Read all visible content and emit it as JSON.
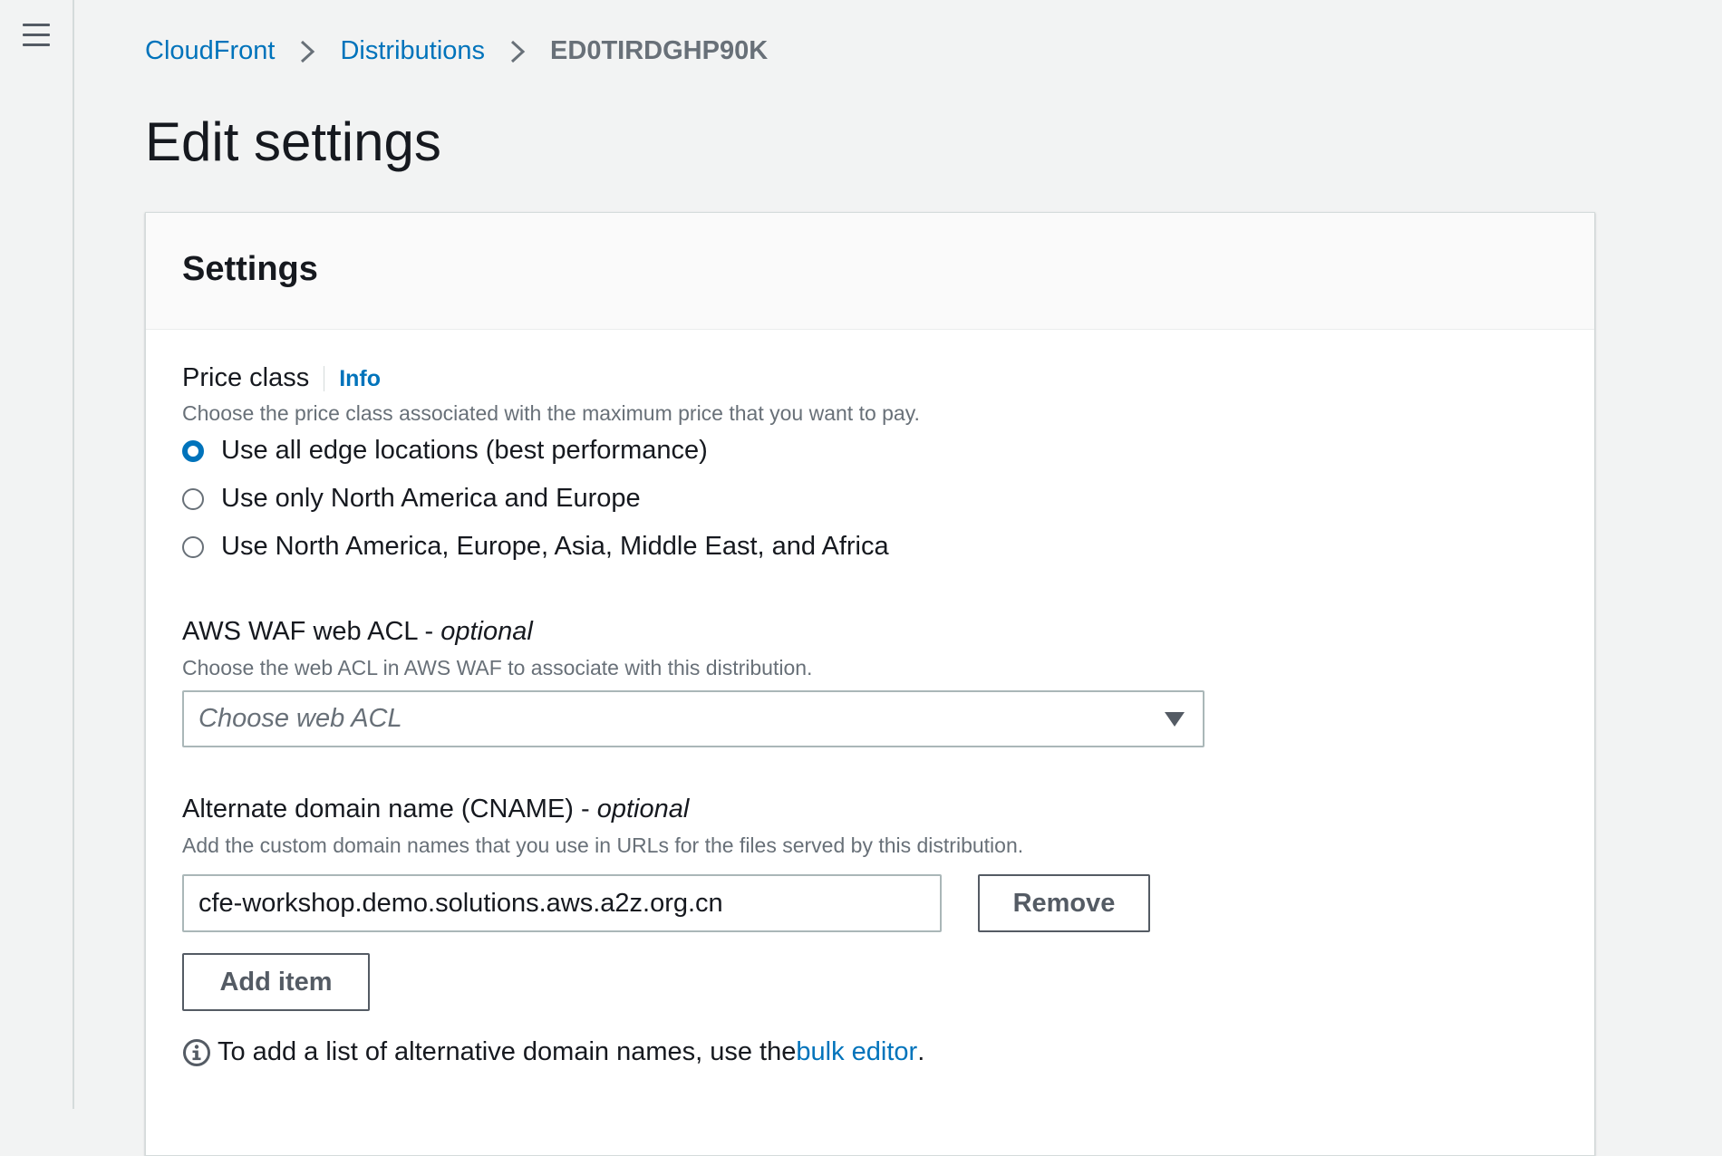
{
  "sidebar": {
    "menu_icon": "hamburger-menu-icon"
  },
  "breadcrumb": {
    "items": [
      {
        "label": "CloudFront"
      },
      {
        "label": "Distributions"
      }
    ],
    "current": "ED0TIRDGHP90K",
    "separator_icon": "chevron-right-icon"
  },
  "page": {
    "title": "Edit settings"
  },
  "settings": {
    "title": "Settings",
    "price_class": {
      "label": "Price class",
      "info_link": "Info",
      "description": "Choose the price class associated with the maximum price that you want to pay.",
      "options": [
        {
          "label": "Use all edge locations (best performance)",
          "selected": true
        },
        {
          "label": "Use only North America and Europe",
          "selected": false
        },
        {
          "label": "Use North America, Europe, Asia, Middle East, and Africa",
          "selected": false
        }
      ]
    },
    "waf": {
      "label": "AWS WAF web ACL - ",
      "optional": "optional",
      "description": "Choose the web ACL in AWS WAF to associate with this distribution.",
      "placeholder": "Choose web ACL",
      "caret_icon": "caret-down-icon"
    },
    "cname": {
      "label": "Alternate domain name (CNAME) - ",
      "optional": "optional",
      "description": "Add the custom domain names that you use in URLs for the files served by this distribution.",
      "value": "cfe-workshop.demo.solutions.aws.a2z.org.cn",
      "remove_label": "Remove",
      "add_label": "Add item",
      "note_icon": "info-circle-icon",
      "note_prefix": "To add a list of alternative domain names, use the ",
      "note_link": "bulk editor",
      "note_suffix": "."
    }
  },
  "colors": {
    "link": "#0073bb",
    "background": "#f2f3f3",
    "text": "#16191f",
    "muted": "#687078",
    "border": "#aab7b8"
  }
}
